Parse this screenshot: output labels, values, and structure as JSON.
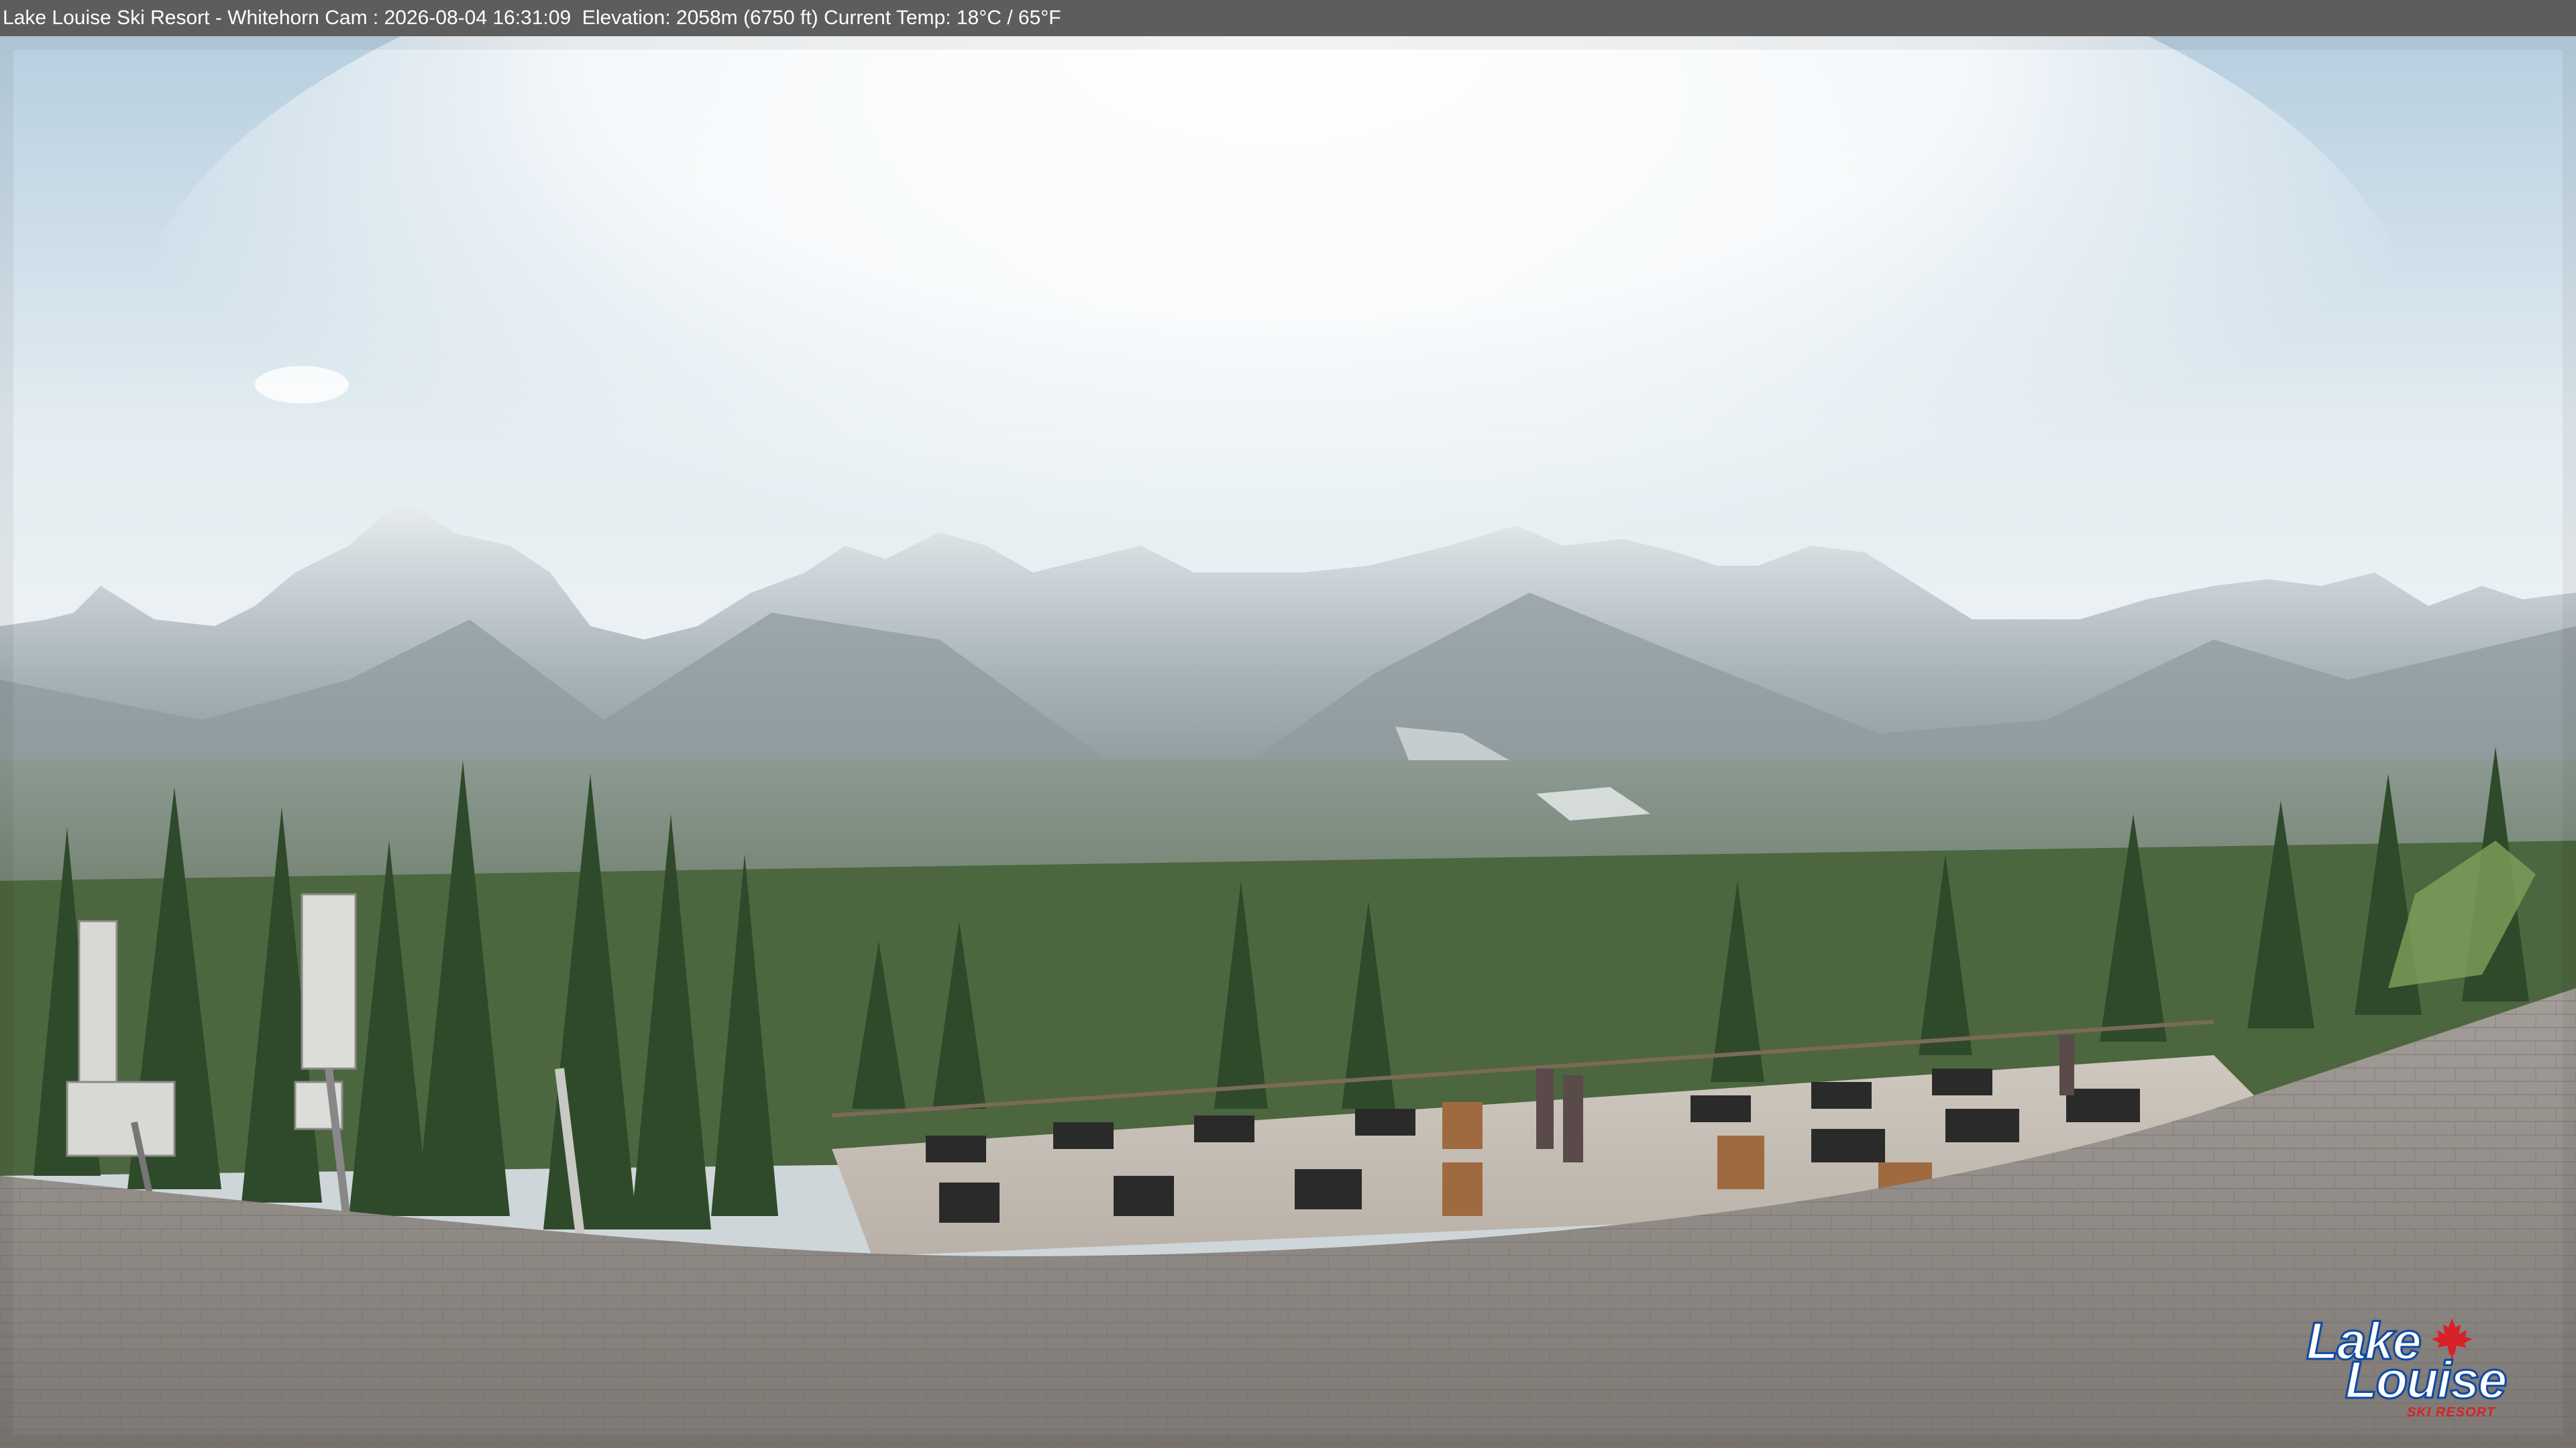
{
  "overlay": {
    "caption": "Lake Louise Ski Resort - Whitehorn Cam : 2026-08-04 16:31:09  Elevation: 2058m (6750 ft) Current Temp: 18°C / 65°F"
  },
  "logo": {
    "line1": "Lake",
    "line2": "Louise",
    "subtitle": "SKI RESORT",
    "leaf_color": "#d82128",
    "text_outline_color": "#0f4aa3"
  },
  "colors": {
    "sky_top": "#c4d8e6",
    "sky_glare": "#ffffff",
    "mountain": "#9aa7b0",
    "forest": "#3e5a34",
    "roof": "#8f8a86",
    "deck": "#d6d0c8"
  }
}
